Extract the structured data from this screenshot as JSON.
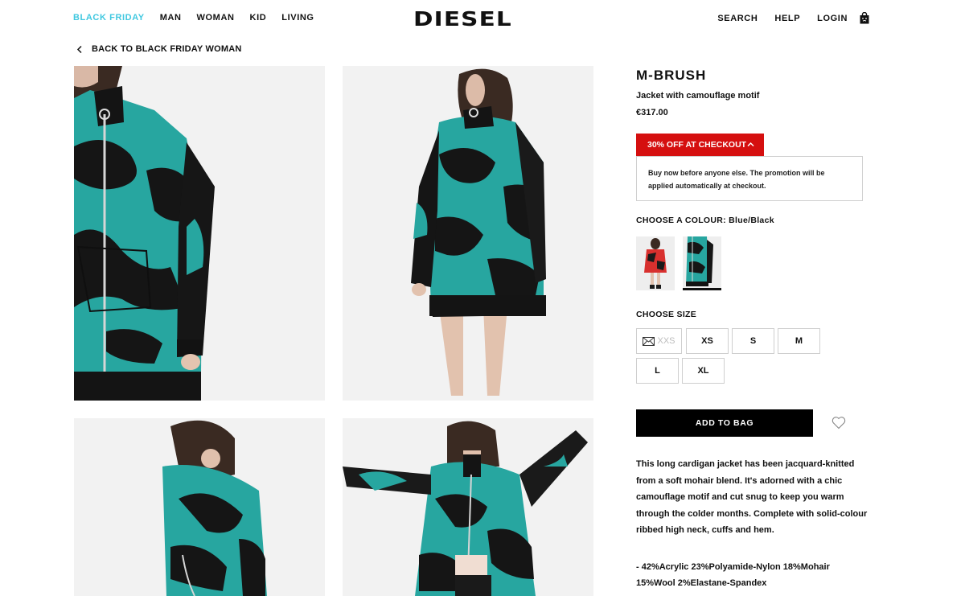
{
  "header": {
    "nav_left": [
      "BLACK FRIDAY",
      "MAN",
      "WOMAN",
      "KID",
      "LIVING"
    ],
    "logo": "DIESEL",
    "nav_right": [
      "SEARCH",
      "HELP",
      "LOGIN"
    ],
    "bag_icon": "shopping-bag-icon",
    "accent_color": "#40c8e0"
  },
  "breadcrumb": {
    "back_label": "BACK TO BLACK FRIDAY WOMAN",
    "icon": "chevron-left-icon"
  },
  "product": {
    "name": "M-BRUSH",
    "description": "Jacket with camouflage motif",
    "price": "€317.00"
  },
  "promo": {
    "label": "30% OFF AT CHECKOUT",
    "details": "Buy now before anyone else. The promotion will be applied automatically at checkout.",
    "color": "#d50f0f",
    "icon": "chevron-up-icon"
  },
  "colour": {
    "label": "CHOOSE A COLOUR: Blue/Black",
    "swatches": [
      "Red/Black",
      "Blue/Black"
    ],
    "selected": "Blue/Black"
  },
  "size": {
    "label": "CHOOSE SIZE",
    "options": [
      "XXS",
      "XS",
      "S",
      "M",
      "L",
      "XL"
    ],
    "unavailable": [
      "XXS"
    ]
  },
  "actions": {
    "add_to_bag": "ADD TO BAG",
    "wishlist_icon": "heart-icon"
  },
  "details": {
    "long_description": "This long cardigan jacket has been jacquard-knitted from a soft mohair blend. It's adorned with a chic camouflage motif and cut snug to keep you warm through the colder months. Complete with solid-colour ribbed high neck, cuffs and hem.",
    "composition_line1": "- 42%Acrylic 23%Polyamide-Nylon 18%Mohair",
    "composition_line2": "15%Wool 2%Elastane-Spandex"
  }
}
